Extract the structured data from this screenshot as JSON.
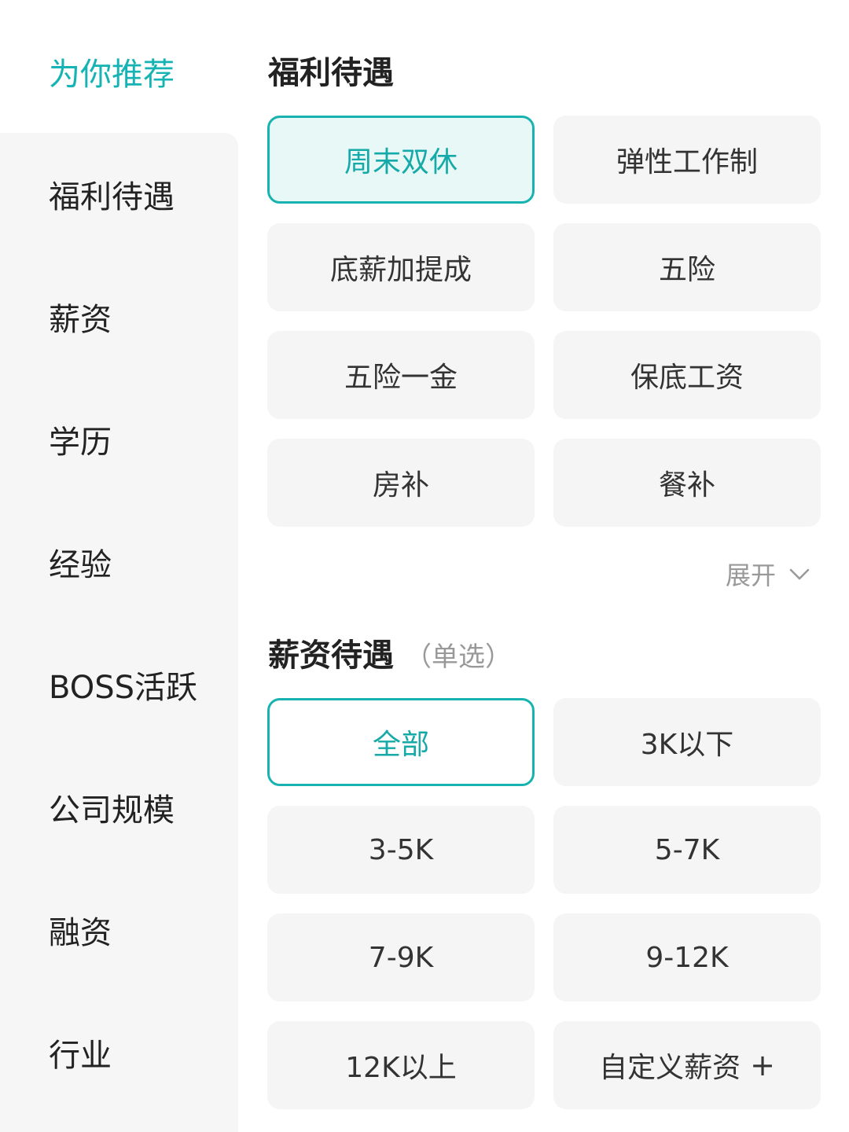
{
  "sidebar": {
    "items": [
      {
        "label": "为你推荐"
      },
      {
        "label": "福利待遇"
      },
      {
        "label": "薪资"
      },
      {
        "label": "学历"
      },
      {
        "label": "经验"
      },
      {
        "label": "BOSS活跃"
      },
      {
        "label": "公司规模"
      },
      {
        "label": "融资"
      },
      {
        "label": "行业"
      }
    ],
    "active_index": 0
  },
  "benefits": {
    "title": "福利待遇",
    "options": [
      {
        "label": "周末双休",
        "selected": true
      },
      {
        "label": "弹性工作制",
        "selected": false
      },
      {
        "label": "底薪加提成",
        "selected": false
      },
      {
        "label": "五险",
        "selected": false
      },
      {
        "label": "五险一金",
        "selected": false
      },
      {
        "label": "保底工资",
        "selected": false
      },
      {
        "label": "房补",
        "selected": false
      },
      {
        "label": "餐补",
        "selected": false
      }
    ],
    "expand_label": "展开"
  },
  "salary": {
    "title": "薪资待遇",
    "note": "（单选）",
    "options": [
      {
        "label": "全部",
        "selected": true
      },
      {
        "label": "3K以下",
        "selected": false
      },
      {
        "label": "3-5K",
        "selected": false
      },
      {
        "label": "5-7K",
        "selected": false
      },
      {
        "label": "7-9K",
        "selected": false
      },
      {
        "label": "9-12K",
        "selected": false
      },
      {
        "label": "12K以上",
        "selected": false
      },
      {
        "label": "自定义薪资",
        "selected": false
      }
    ],
    "custom_suffix": "+"
  },
  "colors": {
    "accent": "#15b3b3",
    "chip_bg": "#f5f5f5",
    "selected_bg": "#e7f8f7"
  },
  "icons": {
    "expand": "chevron-down-icon",
    "custom": "plus-icon"
  }
}
